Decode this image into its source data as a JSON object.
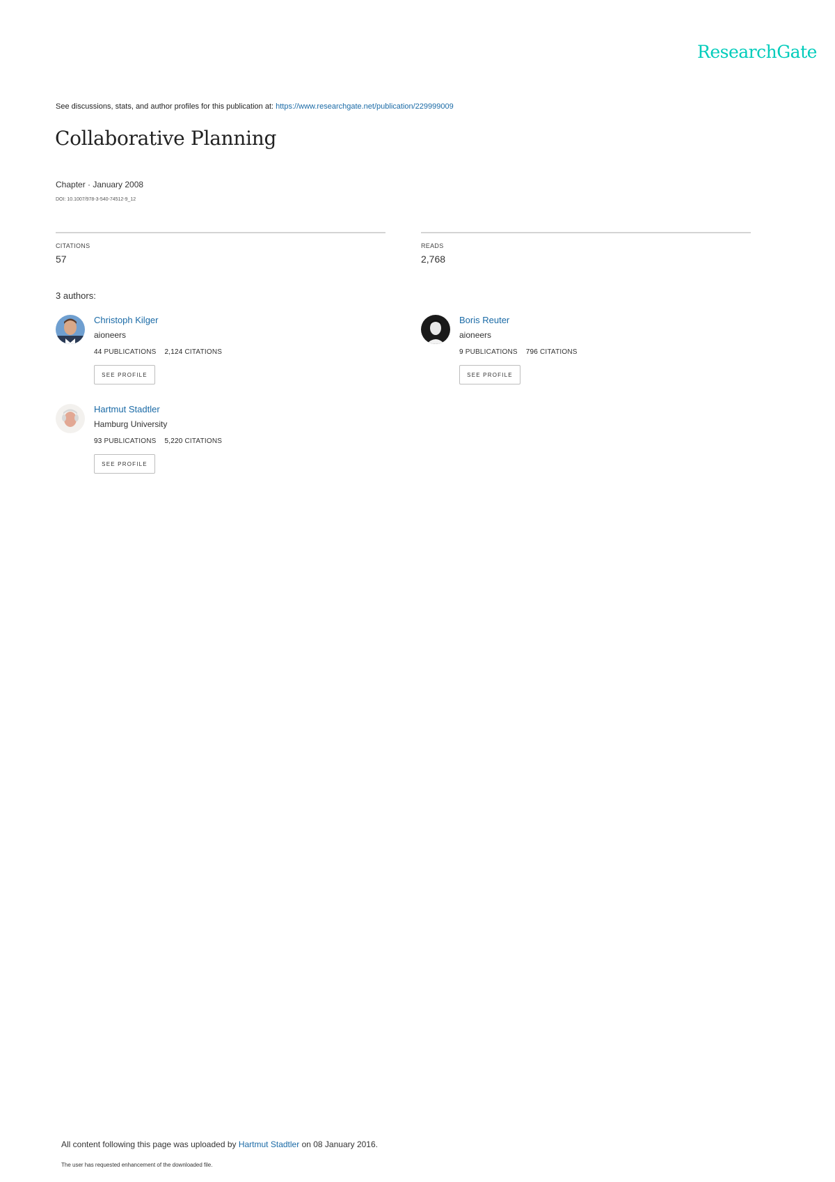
{
  "brand": {
    "logo_text": "ResearchGate",
    "accent_color": "#00ccbb",
    "link_color": "#1a6aa6"
  },
  "header": {
    "see_prefix": "See discussions, stats, and author profiles for this publication at:",
    "see_url": "https://www.researchgate.net/publication/229999009"
  },
  "publication": {
    "title": "Collaborative Planning",
    "chapter_line": "Chapter · January 2008",
    "doi": "DOI: 10.1007/978-3-540-74512-9_12"
  },
  "stats": {
    "citations_label": "CITATIONS",
    "citations_value": "57",
    "reads_label": "READS",
    "reads_value": "2,768"
  },
  "authors_count": "3 authors:",
  "authors": [
    {
      "name": "Christoph Kilger",
      "institution": "aioneers",
      "publications": "44",
      "publications_label": "PUBLICATIONS",
      "citations": "2,124",
      "citations_label": "CITATIONS",
      "button": "SEE PROFILE"
    },
    {
      "name": "Boris Reuter",
      "institution": "aioneers",
      "publications": "9",
      "publications_label": "PUBLICATIONS",
      "citations": "796",
      "citations_label": "CITATIONS",
      "button": "SEE PROFILE"
    },
    {
      "name": "Hartmut Stadtler",
      "institution": "Hamburg University",
      "publications": "93",
      "publications_label": "PUBLICATIONS",
      "citations": "5,220",
      "citations_label": "CITATIONS",
      "button": "SEE PROFILE"
    }
  ],
  "footer": {
    "upload_prefix": "All content following this page was uploaded by",
    "upload_author": "Hartmut Stadtler",
    "upload_suffix": "on 08 January 2016.",
    "note": "The user has requested enhancement of the downloaded file."
  }
}
